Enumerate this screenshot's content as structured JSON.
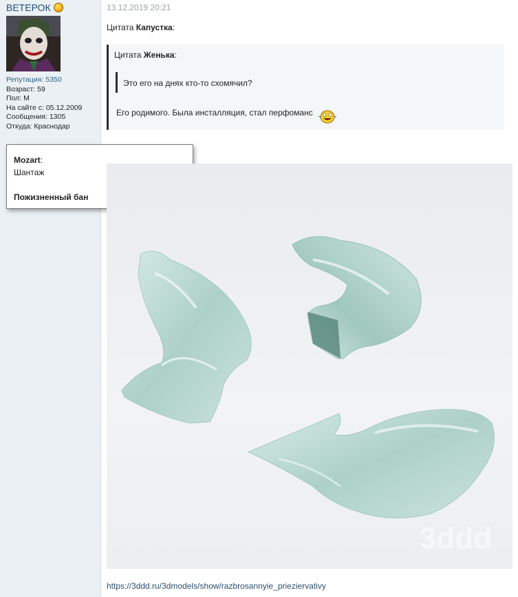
{
  "user": {
    "name": "ВЕТЕРОК",
    "badge_icon": "award-medal-icon",
    "reputation": "Репутация: 5350",
    "age": "Возраст: 59",
    "gender": "Пол: М",
    "since": "На сайте с: 05.12.2009",
    "posts": "Сообщения: 1305",
    "location": "Откуда: Краснодар"
  },
  "popup": {
    "moderator": "Mozart",
    "colon": ":",
    "reason": "Шантаж",
    "penalty": "Пожизненный бан"
  },
  "post": {
    "date": "13.12.2019 20:21",
    "quote_prefix": "Цитата",
    "quote_author_outer": "Капустка",
    "quote_author_inner": "Женька",
    "colon": ":",
    "inner_quote_text": "Это его на днях кто-то схомячил?",
    "reply_text": "Его родимого. Была инсталляция, стал перфоманс",
    "smiley_icon": "laughing-smiley-icon",
    "image_watermark": "3ddd",
    "link": "https://3ddd.ru/3dmodels/show/razbrosannyie_prieziervativy"
  },
  "colors": {
    "sidebar_bg": "#eaf0f4",
    "username": "#1f4e79",
    "date": "#9aa3aa",
    "link": "#2a4f6e"
  }
}
